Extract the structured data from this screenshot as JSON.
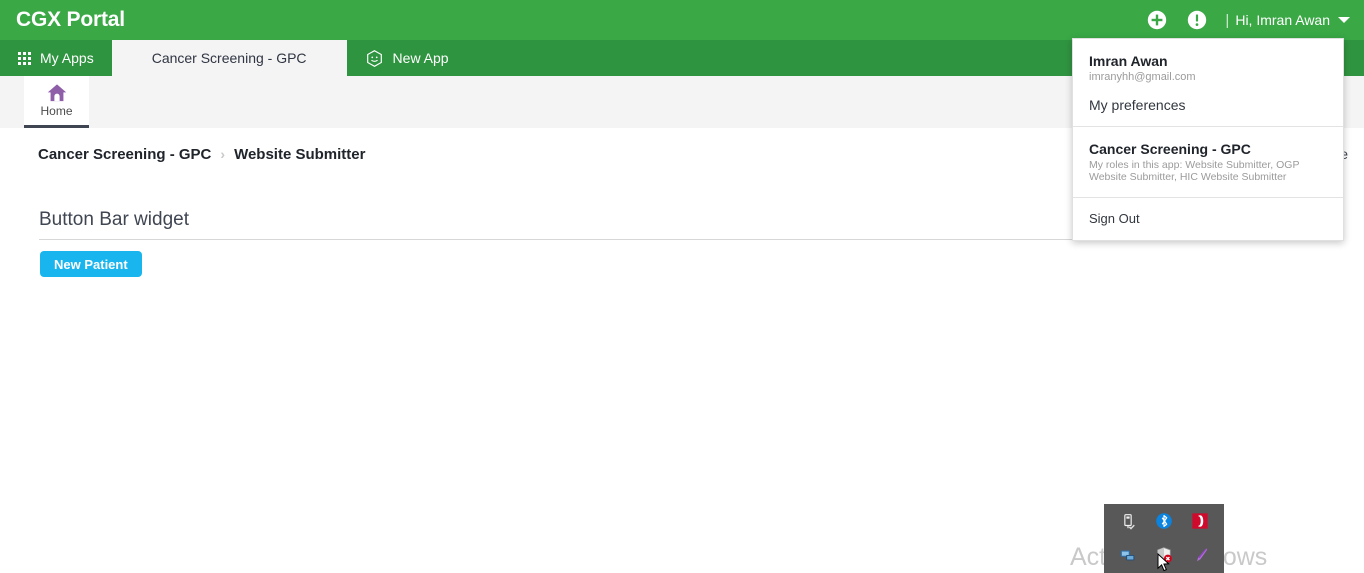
{
  "header": {
    "brand": "CGX Portal",
    "add_icon": "plus-circle-icon",
    "alert_icon": "exclamation-circle-icon",
    "separator": "|",
    "greeting": "Hi, Imran Awan",
    "caret_icon": "chevron-down-icon"
  },
  "tabs": [
    {
      "label": "My Apps",
      "icon": "grid-apps-icon",
      "active": false
    },
    {
      "label": "Cancer Screening - GPC",
      "icon": "",
      "active": true
    },
    {
      "label": "New App",
      "icon": "hexagon-cube-icon",
      "active": false
    }
  ],
  "subbar": {
    "home": {
      "label": "Home",
      "icon": "house-icon"
    }
  },
  "breadcrumb": {
    "parent": "Cancer Screening - GPC",
    "separator": "›",
    "current": "Website Submitter",
    "right_truncated": "e"
  },
  "main": {
    "widget_title": "Button Bar widget",
    "buttons": [
      {
        "label": "New Patient",
        "color": "#19b5ef"
      }
    ]
  },
  "dropdown": {
    "user_name": "Imran Awan",
    "user_email": "imranyhh@gmail.com",
    "preferences_label": "My preferences",
    "app_name": "Cancer Screening - GPC",
    "app_roles": "My roles in this app: Website Submitter, OGP Website Submitter, HIC Website Submitter",
    "sign_out_label": "Sign Out"
  },
  "watermark": {
    "text": "Activate Windows"
  },
  "tray": {
    "icons_top": [
      "usb-icon",
      "bluetooth-icon",
      "opera-icon"
    ],
    "icons_bottom": [
      "network-icon",
      "shield-alert-icon",
      "pen-icon"
    ]
  },
  "colors": {
    "header_green": "#39a845",
    "tabbar_green": "#2f9440",
    "button_blue": "#19b5ef",
    "home_purple": "#8e5fa8"
  }
}
